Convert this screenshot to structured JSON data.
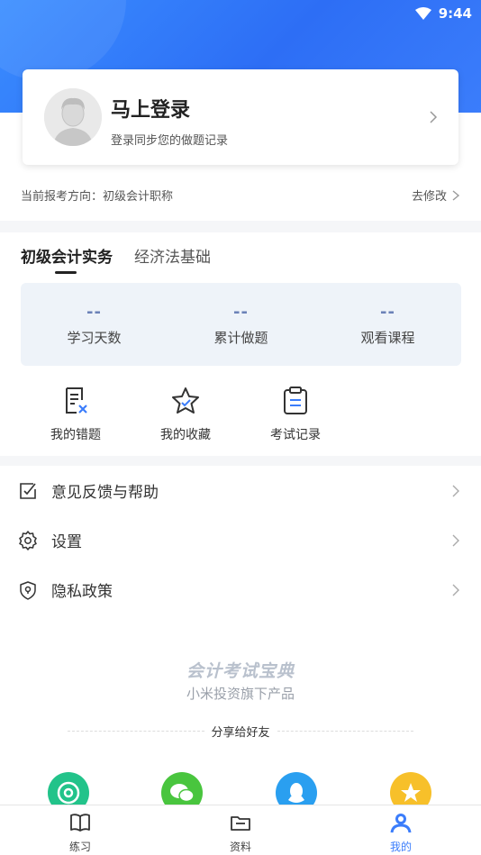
{
  "status_bar": {
    "time": "9:44"
  },
  "login": {
    "title": "马上登录",
    "subtitle": "登录同步您的做题记录"
  },
  "direction": {
    "label": "当前报考方向：初级会计职称",
    "edit": "去修改"
  },
  "tabs": [
    {
      "label": "初级会计实务",
      "active": true
    },
    {
      "label": "经济法基础",
      "active": false
    }
  ],
  "stats": [
    {
      "value": "--",
      "label": "学习天数"
    },
    {
      "value": "--",
      "label": "累计做题"
    },
    {
      "value": "--",
      "label": "观看课程"
    }
  ],
  "quick_actions": [
    {
      "label": "我的错题",
      "icon": "wrong-questions-icon"
    },
    {
      "label": "我的收藏",
      "icon": "star-icon"
    },
    {
      "label": "考试记录",
      "icon": "clipboard-icon"
    }
  ],
  "menu": [
    {
      "label": "意见反馈与帮助",
      "icon": "feedback-icon"
    },
    {
      "label": "设置",
      "icon": "gear-icon"
    },
    {
      "label": "隐私政策",
      "icon": "shield-icon"
    }
  ],
  "brand": {
    "name": "会计考试宝典",
    "subtitle": "小米投资旗下产品"
  },
  "share": {
    "title": "分享给好友",
    "targets": [
      {
        "icon": "moments-icon",
        "color": "#22c38a"
      },
      {
        "icon": "wechat-icon",
        "color": "#49c53e"
      },
      {
        "icon": "qq-icon",
        "color": "#2a9ff0"
      },
      {
        "icon": "qzone-icon",
        "color": "#f7c02a"
      }
    ]
  },
  "bottom_nav": [
    {
      "label": "练习",
      "icon": "book-icon",
      "active": false
    },
    {
      "label": "资料",
      "icon": "folder-icon",
      "active": false
    },
    {
      "label": "我的",
      "icon": "person-icon",
      "active": true
    }
  ],
  "colors": {
    "accent": "#3b7dfb",
    "stat_value": "#6b82b8"
  }
}
